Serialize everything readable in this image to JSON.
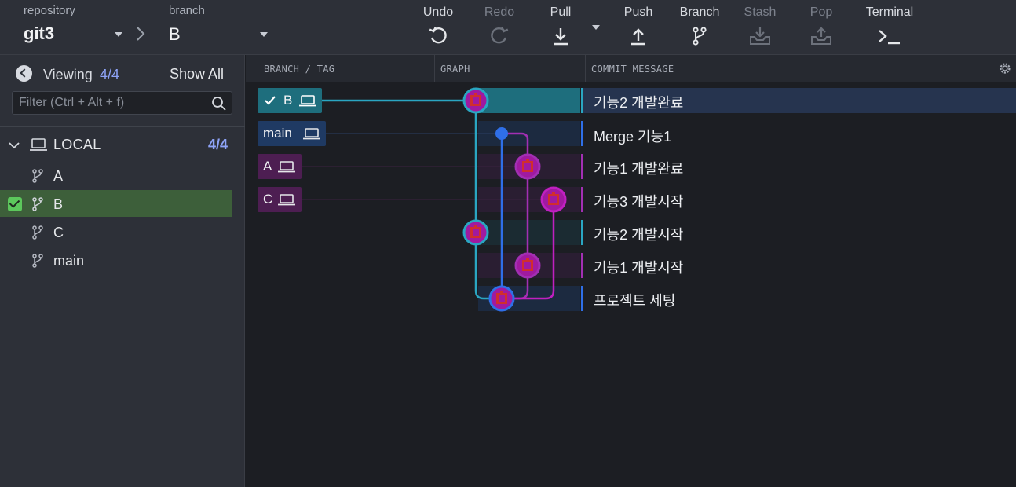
{
  "toolbar": {
    "repo_caption": "repository",
    "repo_name": "git3",
    "branch_caption": "branch",
    "branch_name": "B",
    "undo": "Undo",
    "redo": "Redo",
    "pull": "Pull",
    "push": "Push",
    "branch": "Branch",
    "stash": "Stash",
    "pop": "Pop",
    "terminal": "Terminal"
  },
  "left_panel": {
    "viewing_label": "Viewing",
    "viewing_count": "4/4",
    "show_all": "Show All",
    "filter_placeholder": "Filter (Ctrl + Alt + f)",
    "local_label": "LOCAL",
    "local_count": "4/4",
    "branches": [
      {
        "name": "A",
        "checked": false
      },
      {
        "name": "B",
        "checked": true
      },
      {
        "name": "C",
        "checked": false
      },
      {
        "name": "main",
        "checked": false
      }
    ]
  },
  "graph": {
    "headers": {
      "branch_tag": "BRANCH / TAG",
      "graph": "GRAPH",
      "commit_message": "COMMIT MESSAGE"
    },
    "refs": [
      {
        "name": "B",
        "checked": true,
        "color": "#1e6e7d"
      },
      {
        "name": "main",
        "checked": false,
        "color": "#1f3a63"
      },
      {
        "name": "A",
        "checked": false,
        "color": "#4d1e52"
      },
      {
        "name": "C",
        "checked": false,
        "color": "#4d1e52"
      }
    ],
    "commits": [
      {
        "message": "기능2 개발완료",
        "lane_color": "#2aa6c2",
        "selected": true
      },
      {
        "message": "Merge 기능1",
        "lane_color": "#2f6fe8",
        "selected": false
      },
      {
        "message": "기능1 개발완료",
        "lane_color": "#a22fb3",
        "selected": false
      },
      {
        "message": "기능3 개발시작",
        "lane_color": "#a22fb3",
        "selected": false
      },
      {
        "message": "기능2 개발시작",
        "lane_color": "#2aa6c2",
        "selected": false
      },
      {
        "message": "기능1 개발시작",
        "lane_color": "#a22fb3",
        "selected": false
      },
      {
        "message": "프로젝트 세팅",
        "lane_color": "#2f6fe8",
        "selected": false
      }
    ]
  },
  "colors": {
    "cyan": "#2aa6c2",
    "blue": "#2f6fe8",
    "magenta": "#b02bc0",
    "purple": "#8a3fb0",
    "selected_row": "#26344f",
    "active_branch": "#3d5f3a",
    "accent": "#8ea3f7"
  }
}
